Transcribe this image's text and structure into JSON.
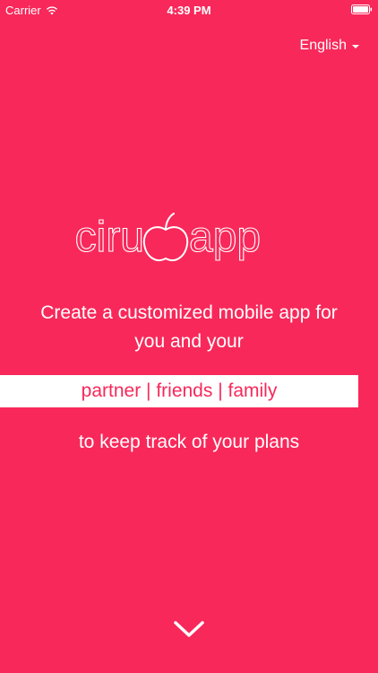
{
  "status_bar": {
    "carrier": "Carrier",
    "time": "4:39 PM"
  },
  "language": {
    "selected": "English"
  },
  "logo": {
    "left_text": "ciru",
    "right_text": "app"
  },
  "tagline": {
    "line1": "Create a customized mobile app for",
    "line2": "you and your"
  },
  "highlight": {
    "text": "partner | friends | family"
  },
  "subline": {
    "text": "to keep track of your plans"
  },
  "colors": {
    "background": "#f8285a",
    "text": "#ffffff",
    "highlight_bg": "#ffffff"
  },
  "icons": {
    "wifi": "wifi-icon",
    "battery": "battery-icon",
    "language_caret": "caret-down-icon",
    "apple": "apple-icon",
    "scroll": "chevron-down-icon"
  }
}
